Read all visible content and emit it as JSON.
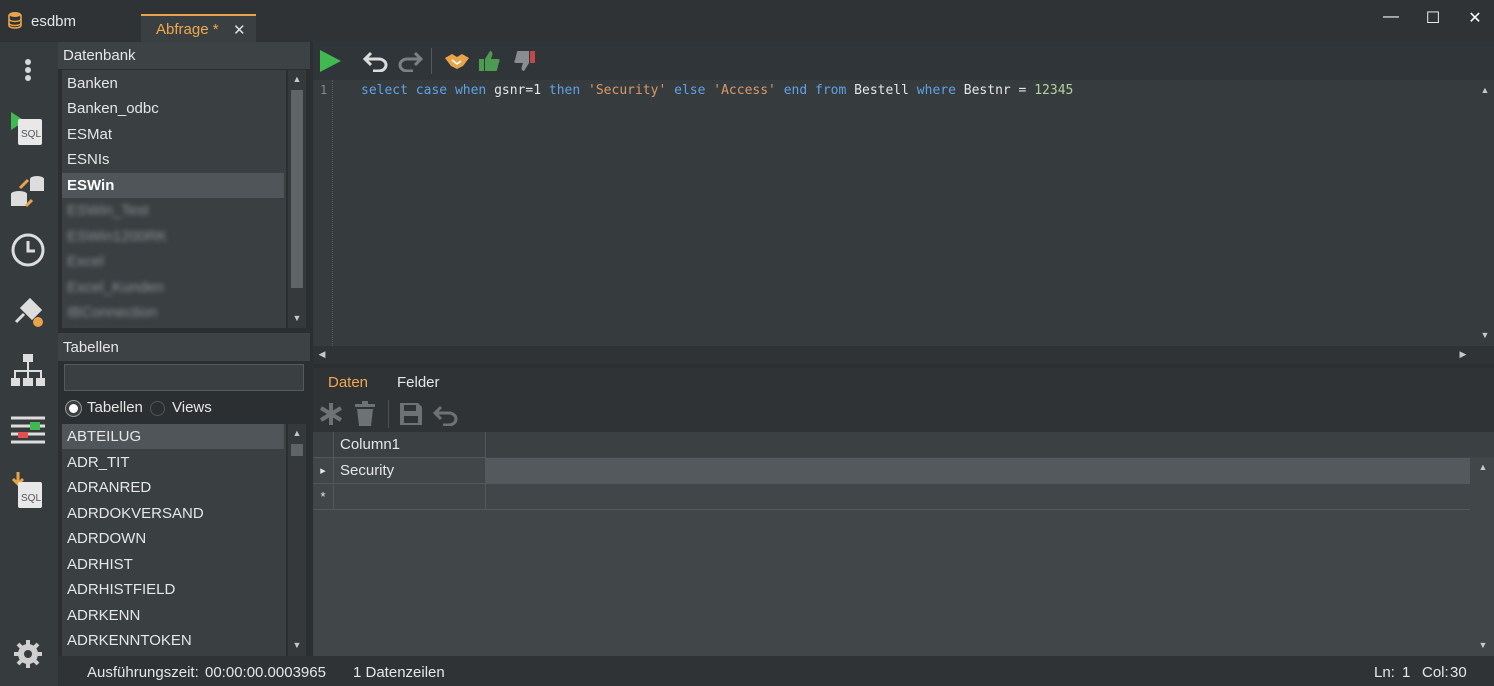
{
  "app": {
    "title": "esdbm"
  },
  "tabs": [
    {
      "label": "Abfrage *",
      "close": "✕"
    }
  ],
  "window_controls": {
    "minimize": "—",
    "maximize": "☐",
    "close": "✕"
  },
  "sidebar_icons": [
    "more-vertical-icon",
    "sql-run-icon",
    "database-transfer-icon",
    "clock-icon",
    "plug-settings-icon",
    "hierarchy-icon",
    "sliders-compare-icon",
    "sql-import-icon",
    "gear-icon"
  ],
  "database_panel": {
    "title": "Datenbank",
    "items": [
      "Banken",
      "Banken_odbc",
      "ESMat",
      "ESNIs",
      "ESWin",
      "ESWin_Test",
      "ESWin1200RK",
      "Excel",
      "Excel_Kunden",
      "IBConnection"
    ],
    "selected": "ESWin"
  },
  "tables_panel": {
    "title": "Tabellen",
    "search_value": "",
    "radio_tables": "Tabellen",
    "radio_views": "Views",
    "items": [
      "ABTEILUG",
      "ADR_TIT",
      "ADRANRED",
      "ADRDOKVERSAND",
      "ADRDOWN",
      "ADRHIST",
      "ADRHISTFIELD",
      "ADRKENN",
      "ADRKENNTOKEN"
    ],
    "selected": "ABTEILUG"
  },
  "editor": {
    "line_number": "1",
    "tokens": [
      {
        "t": "select",
        "c": "kw"
      },
      {
        "t": " ",
        "c": ""
      },
      {
        "t": "case",
        "c": "kw"
      },
      {
        "t": " ",
        "c": ""
      },
      {
        "t": "when",
        "c": "kw"
      },
      {
        "t": " gsnr=1 ",
        "c": ""
      },
      {
        "t": "then",
        "c": "kw"
      },
      {
        "t": " ",
        "c": ""
      },
      {
        "t": "'Security'",
        "c": "str"
      },
      {
        "t": " ",
        "c": ""
      },
      {
        "t": "else",
        "c": "kw"
      },
      {
        "t": " ",
        "c": ""
      },
      {
        "t": "'Access'",
        "c": "str"
      },
      {
        "t": " ",
        "c": ""
      },
      {
        "t": "end",
        "c": "kw"
      },
      {
        "t": " ",
        "c": ""
      },
      {
        "t": "from",
        "c": "kw"
      },
      {
        "t": " Bestell ",
        "c": ""
      },
      {
        "t": "where",
        "c": "kw"
      },
      {
        "t": " Bestnr = ",
        "c": ""
      },
      {
        "t": "12345",
        "c": "num"
      }
    ]
  },
  "result_tabs": {
    "data": "Daten",
    "fields": "Felder"
  },
  "grid": {
    "columns": [
      "Column1"
    ],
    "rows": [
      [
        "Security"
      ]
    ],
    "new_row_marker": "*",
    "current_row_marker": "▸"
  },
  "status": {
    "exec_label": "Ausführungszeit:",
    "exec_value": "00:00:00.0003965",
    "rows": "1 Datenzeilen",
    "ln_label": "Ln:",
    "ln_value": "1",
    "col_label": "Col:",
    "col_value": "30"
  },
  "colors": {
    "accent": "#f0a84e",
    "keyword": "#5ea2e8",
    "string": "#d89a6a",
    "number": "#b5d19b",
    "run_green": "#3fb950"
  }
}
